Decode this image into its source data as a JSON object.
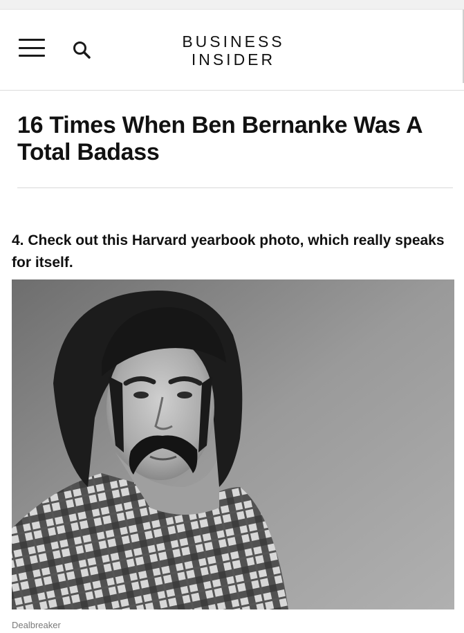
{
  "header": {
    "logo_line1": "BUSINESS",
    "logo_line2": "INSIDER",
    "menu_icon": "hamburger-menu-icon",
    "search_icon": "search-icon"
  },
  "article": {
    "headline": "16 Times When Ben Bernanke Was A Total Badass",
    "slide": {
      "title": "4. Check out this Harvard yearbook photo, which really speaks for itself.",
      "photo_credit": "Dealbreaker"
    }
  },
  "colors": {
    "text": "#111111",
    "credit": "#7a7a7a",
    "divider": "#d8d8d8"
  }
}
